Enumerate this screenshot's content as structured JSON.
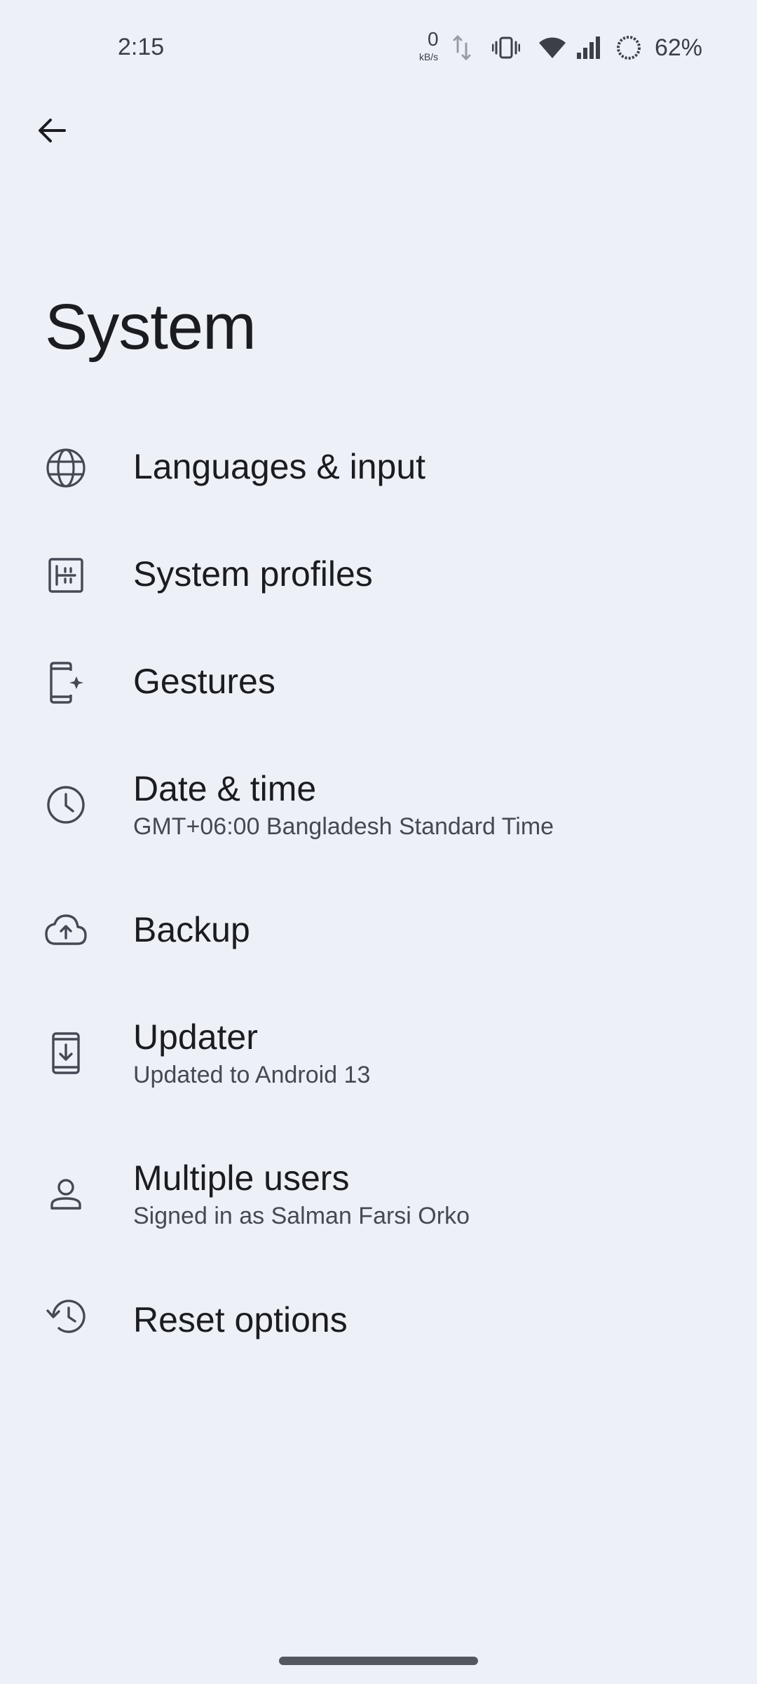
{
  "status_bar": {
    "time": "2:15",
    "net_speed_value": "0",
    "net_speed_unit": "kB/s",
    "battery_percent": "62%"
  },
  "page": {
    "title": "System"
  },
  "settings": [
    {
      "id": "languages",
      "icon": "globe-icon",
      "title": "Languages & input",
      "summary": ""
    },
    {
      "id": "system-profiles",
      "icon": "system-profiles-icon",
      "title": "System profiles",
      "summary": ""
    },
    {
      "id": "gestures",
      "icon": "gestures-phone-icon",
      "title": "Gestures",
      "summary": ""
    },
    {
      "id": "date-time",
      "icon": "clock-icon",
      "title": "Date & time",
      "summary": "GMT+06:00 Bangladesh Standard Time"
    },
    {
      "id": "backup",
      "icon": "cloud-upload-icon",
      "title": "Backup",
      "summary": ""
    },
    {
      "id": "updater",
      "icon": "system-update-icon",
      "title": "Updater",
      "summary": "Updated to Android 13"
    },
    {
      "id": "multiple-users",
      "icon": "person-icon",
      "title": "Multiple users",
      "summary": "Signed in as Salman Farsi Orko"
    },
    {
      "id": "reset-options",
      "icon": "history-icon",
      "title": "Reset options",
      "summary": ""
    }
  ],
  "colors": {
    "background": "#eef0f8",
    "text_primary": "#1b1c22",
    "text_secondary": "#464853",
    "icon": "#464853"
  }
}
